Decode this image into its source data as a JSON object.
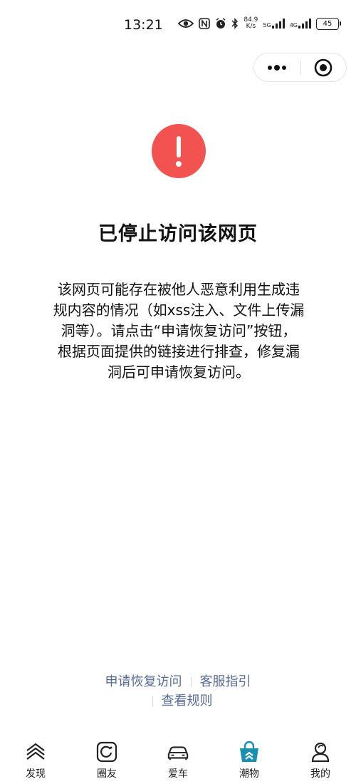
{
  "status_bar": {
    "time": "13:21",
    "net_speed_value": "84.9",
    "net_speed_unit": "K/s",
    "signal1_label": "5G",
    "signal2_label": "4G",
    "battery": "45"
  },
  "capsule": {
    "more_icon": "more-dots-icon",
    "close_icon": "close-circle-icon"
  },
  "warning": {
    "icon": "exclamation-icon",
    "color": "#f25350"
  },
  "title": "已停止访问该网页",
  "description_lines": [
    "该网页可能存在被他人恶意利用生成违",
    "规内容的情况（如xss注入、文件上传漏",
    "洞等）。请点击“申请恢复访问”按钮，",
    "根据页面提供的链接进行排查，修复漏",
    "洞后可申请恢复访问。"
  ],
  "links": {
    "request_restore": "申请恢复访问",
    "customer_service": "客服指引",
    "view_rules": "查看规则",
    "color": "#576b95"
  },
  "tabbar": {
    "items": [
      {
        "label": "发现",
        "icon": "discover-icon"
      },
      {
        "label": "圈友",
        "icon": "friends-circle-icon"
      },
      {
        "label": "爱车",
        "icon": "car-icon"
      },
      {
        "label": "潮物",
        "icon": "shopping-bag-icon",
        "active": true
      },
      {
        "label": "我的",
        "icon": "profile-icon"
      }
    ],
    "active_color": "#1a8fb0"
  }
}
